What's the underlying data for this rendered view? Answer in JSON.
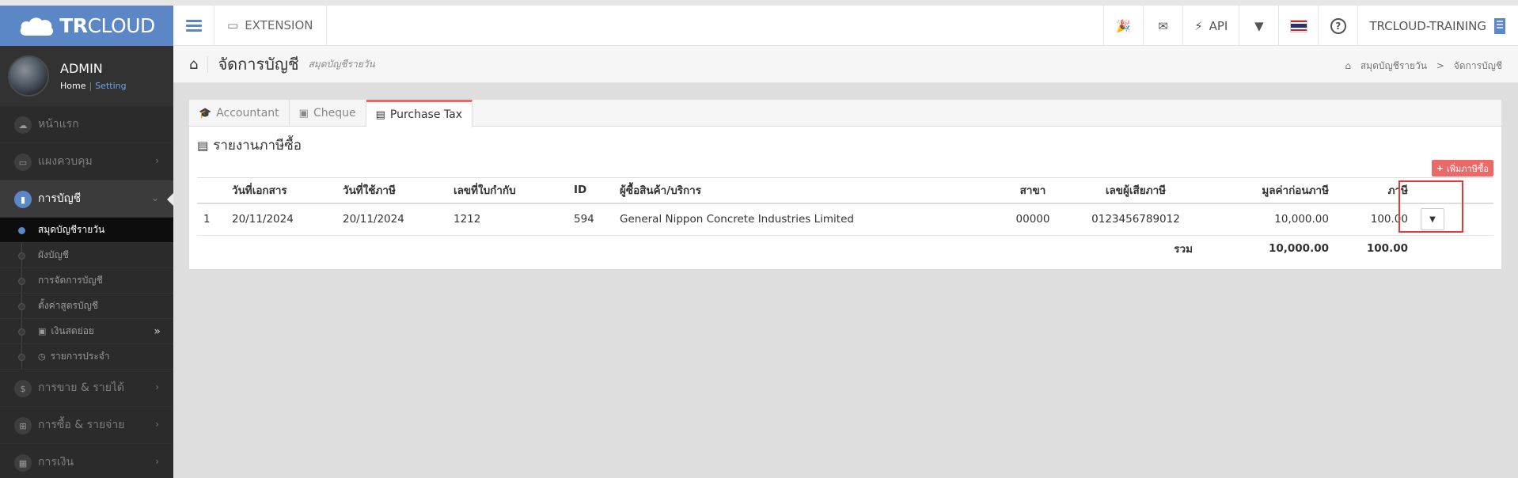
{
  "app": {
    "logo_bold": "TR",
    "logo_light": "CLOUD"
  },
  "profile": {
    "name": "ADMIN",
    "home_link": "Home",
    "separator": "|",
    "setting_link": "Setting"
  },
  "sidebar": {
    "items": [
      {
        "label": "หน้าแรก",
        "icon": "cloud-icon"
      },
      {
        "label": "แผงควบคุม",
        "icon": "monitor-icon"
      },
      {
        "label": "การบัญชี",
        "icon": "book-icon"
      },
      {
        "label": "การขาย & รายได้",
        "icon": "dollar-icon"
      },
      {
        "label": "การซื้อ & รายจ่าย",
        "icon": "cart-icon"
      },
      {
        "label": "การเงิน",
        "icon": "calendar-icon"
      }
    ],
    "sub_items": [
      {
        "label": "สมุดบัญชีรายวัน"
      },
      {
        "label": "ผังบัญชี"
      },
      {
        "label": "การจัดการบัญชี"
      },
      {
        "label": "ตั้งค่าสูตรบัญชี"
      },
      {
        "label": "เงินสดย่อย"
      },
      {
        "label": "รายการประจำ"
      }
    ]
  },
  "topbar": {
    "extension_label": "EXTENSION",
    "api_label": "API",
    "company_label": "TRCLOUD-TRAINING"
  },
  "page_header": {
    "title": "จัดการบัญชี",
    "subtitle": "สมุดบัญชีรายวัน",
    "breadcrumb": [
      "สมุดบัญชีรายวัน",
      "จัดการบัญชี"
    ],
    "breadcrumb_sep": ">"
  },
  "tabs": [
    {
      "label": "Accountant"
    },
    {
      "label": "Cheque"
    },
    {
      "label": "Purchase Tax"
    }
  ],
  "section": {
    "title": "รายงานภาษีซื้อ",
    "add_button": "เพิ่มภาษีซื้อ"
  },
  "table": {
    "headers": [
      "",
      "วันที่เอกสาร",
      "วันที่ใช้ภาษี",
      "เลขที่ใบกำกับ",
      "ID",
      "ผู้ซื้อสินค้า/บริการ",
      "สาขา",
      "เลขผู้เสียภาษี",
      "มูลค่าก่อนภาษี",
      "ภาษี",
      ""
    ],
    "rows": [
      {
        "no": "1",
        "doc_date": "20/11/2024",
        "tax_date": "20/11/2024",
        "invoice_no": "1212",
        "id": "594",
        "vendor": "General Nippon Concrete Industries Limited",
        "branch": "00000",
        "tax_id": "0123456789012",
        "pre_tax": "10,000.00",
        "tax": "100.00"
      }
    ],
    "total": {
      "label": "รวม",
      "pre_tax": "10,000.00",
      "tax": "100.00"
    }
  },
  "colors": {
    "brand": "#5b87c7",
    "accent": "#ea6a6a",
    "sidebar_bg": "#2b2b2b",
    "highlight": "#e53935"
  }
}
